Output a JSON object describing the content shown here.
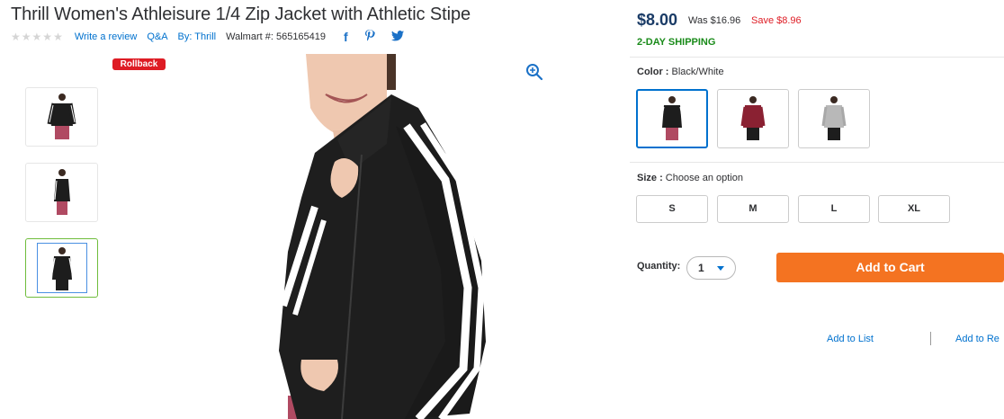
{
  "product": {
    "title": "Thrill Women's Athleisure 1/4 Zip Jacket with Athletic Stipe",
    "write_review": "Write a review",
    "qa": "Q&A",
    "brand": "By: Thrill",
    "walmart_number": "Walmart #: 565165419",
    "rating_stars": 0,
    "badge": "Rollback"
  },
  "pricing": {
    "price": "$8.00",
    "was": "Was $16.96",
    "save": "Save $8.96",
    "shipping": "2-DAY SHIPPING"
  },
  "color": {
    "label": "Color :",
    "selected": "Black/White",
    "options": [
      "black-white",
      "burgundy",
      "heather-gray"
    ]
  },
  "size": {
    "label": "Size :",
    "prompt": "Choose an option",
    "options": [
      "S",
      "M",
      "L",
      "XL"
    ]
  },
  "quantity": {
    "label": "Quantity:",
    "value": "1"
  },
  "actions": {
    "add_to_cart": "Add to Cart",
    "add_to_list": "Add to List",
    "add_to_registry": "Add to Re"
  },
  "icons": {
    "facebook": "facebook-icon",
    "pinterest": "pinterest-icon",
    "twitter": "twitter-icon",
    "zoom": "zoom-in-icon"
  },
  "colors": {
    "link": "#0071ce",
    "price": "#1a3b66",
    "sale": "#de1c24",
    "shipping": "#1a8b1a",
    "cart": "#f47321"
  }
}
